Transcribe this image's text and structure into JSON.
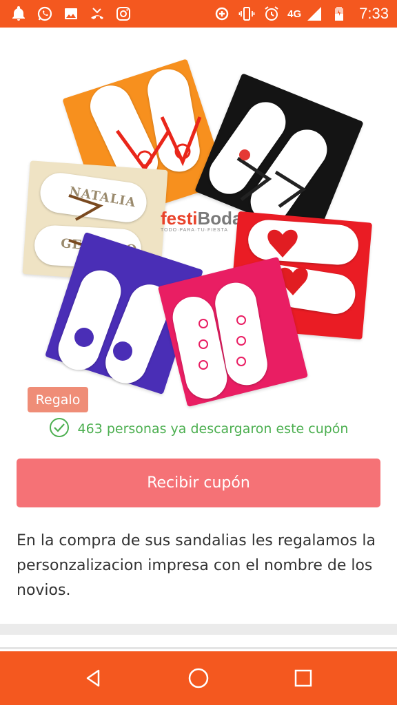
{
  "status_bar": {
    "network": "4G",
    "time": "7:33",
    "icons_left": [
      "notification-bell-icon",
      "whatsapp-icon",
      "image-icon",
      "missed-call-icon",
      "instagram-icon"
    ],
    "icons_right": [
      "data-saver-icon",
      "vibrate-icon",
      "alarm-icon",
      "signal-icon",
      "battery-icon"
    ]
  },
  "product_image": {
    "logo_main_part1": "festi",
    "logo_main_part2": "Boda",
    "logo_sub": "TODO·PARA·TU·FIESTA",
    "prints": [
      "NATALIA",
      "GERARDO"
    ]
  },
  "badge": {
    "label": "Regalo"
  },
  "downloads": {
    "text": "463 personas ya descargaron este cupón"
  },
  "cta": {
    "label": "Recibir cupón"
  },
  "description": {
    "text": "En la compra de sus sandalias les regalamos la personzalizacion impresa con el nombre de los novios."
  },
  "colors": {
    "accent_orange": "#f4581f",
    "cta_pink": "#f57276",
    "badge_salmon": "#ef8d77",
    "success_green": "#4caf50"
  },
  "nav_bar": {
    "buttons": [
      "back",
      "home",
      "recents"
    ]
  }
}
